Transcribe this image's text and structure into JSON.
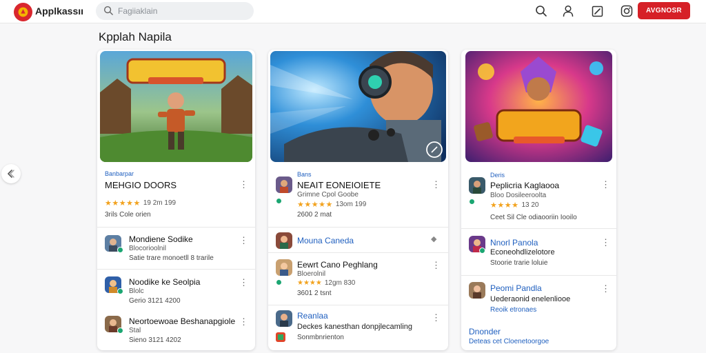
{
  "header": {
    "app_title": "Applkassıı",
    "search_placeholder": "Fagiiaklain",
    "cta_label": "AVGNOSR",
    "icons": [
      "search-icon",
      "user-icon",
      "edit-icon",
      "instagram-icon"
    ]
  },
  "section_title": "Kpplah Napila",
  "colors": {
    "accent": "#d62027",
    "link": "#1f5fbf",
    "star": "#f2a21d",
    "verified": "#1ba672"
  },
  "columns": [
    {
      "featured": {
        "category": "Banbarpar",
        "title": "MEHGIO DOORS",
        "stars": "★★★★★",
        "rating_text": "19 2m 199",
        "meta": "3rils Cole orien"
      },
      "items": [
        {
          "name": "Mondiene Sodike",
          "sub": "Blocorioolnil",
          "stat": "Satie trare monoetll 8 trarile"
        },
        {
          "name": "Noodike ke Seolpia",
          "sub": "Blolc",
          "stat": "Gerio 3121 4200"
        },
        {
          "name": "Neortoewoae Beshanapgiole",
          "sub": "Stal",
          "stat": "Sieno 3121 4202"
        }
      ]
    },
    {
      "featured": {
        "category": "Bans",
        "title": "NEAIT EONEIOIETE",
        "stars": "★★★★★",
        "rating_text": "13om 199",
        "sub": "Grimne Cpol Goobe",
        "meta": "2600 2 mat"
      },
      "items": [
        {
          "name": "Mouna Caneda",
          "sub": "",
          "stat": ""
        },
        {
          "name": "Eewrt Cano Peghlang",
          "sub": "Bloerolnil",
          "stars": "★★★★",
          "stat": "12gm 830"
        },
        {
          "name": "Reanlaa",
          "sub": "Deckes kanesthan donpjlecamling",
          "stat": "Sonmbnrienton"
        }
      ],
      "item2_meta": "3601 2 tsnt"
    },
    {
      "featured": {
        "category": "Deris",
        "title": "Peplicria Kaglaooa",
        "stars": "★★★★",
        "rating_text": "13 20",
        "sub": "Bloo Dosileeroolta",
        "meta": "Ceet Sil Cle odiaooriin Iooilo"
      },
      "items": [
        {
          "name": "Nnorl Panola",
          "sub": "Econeohdlizelotore",
          "stat": "Stoorie trarie loluie"
        },
        {
          "name": "Peomi Pandla",
          "sub": "Uederaonid enelenliooe",
          "stat": "Reoik etronaes"
        }
      ],
      "footer_name": "Dnonder",
      "footer_sub": "Deteas cet Cloenetoorgoe"
    }
  ]
}
